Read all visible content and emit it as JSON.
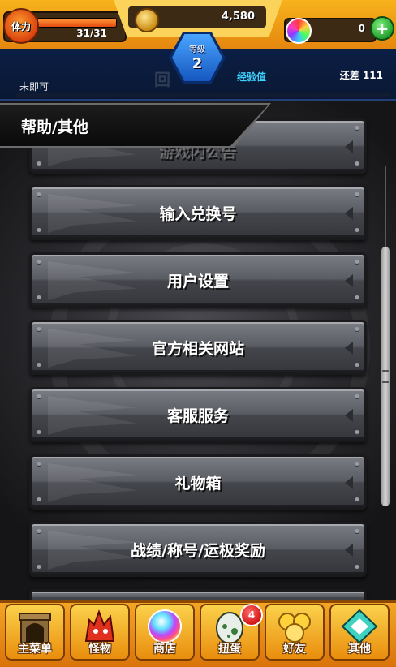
{
  "topbar": {
    "stamina_label": "体力",
    "stamina_value": "31/31",
    "stamina_fraction": 1.0,
    "coins": "4,580",
    "gems": "0",
    "gem_plus": "+"
  },
  "player": {
    "level_label": "等级",
    "level_value": "2",
    "exp_label": "经验值",
    "remaining_label": "还差 111",
    "exp_fraction": 0.0,
    "status_text": "未即可"
  },
  "section": {
    "title": "帮助/其他",
    "background_title": "回"
  },
  "menu": {
    "partial_item": "游戏内公告",
    "items": [
      {
        "label": "输入兑换号"
      },
      {
        "label": "用户设置"
      },
      {
        "label": "官方相关网站"
      },
      {
        "label": "客服服务"
      },
      {
        "label": "礼物箱"
      },
      {
        "label": "战绩/称号/运极奖励"
      }
    ]
  },
  "nav": {
    "items": [
      {
        "label": "主菜单",
        "icon": "castle-icon"
      },
      {
        "label": "怪物",
        "icon": "monster-icon"
      },
      {
        "label": "商店",
        "icon": "rainbow-orb-icon"
      },
      {
        "label": "扭蛋",
        "icon": "egg-icon",
        "badge": "4"
      },
      {
        "label": "好友",
        "icon": "friends-icon"
      },
      {
        "label": "其他",
        "icon": "other-icon"
      }
    ]
  },
  "colors": {
    "accent_orange": "#f7b21c",
    "info_blue": "#0b1e45",
    "exp_cyan": "#3fd2ff",
    "button_grey": "#5a5c63"
  }
}
